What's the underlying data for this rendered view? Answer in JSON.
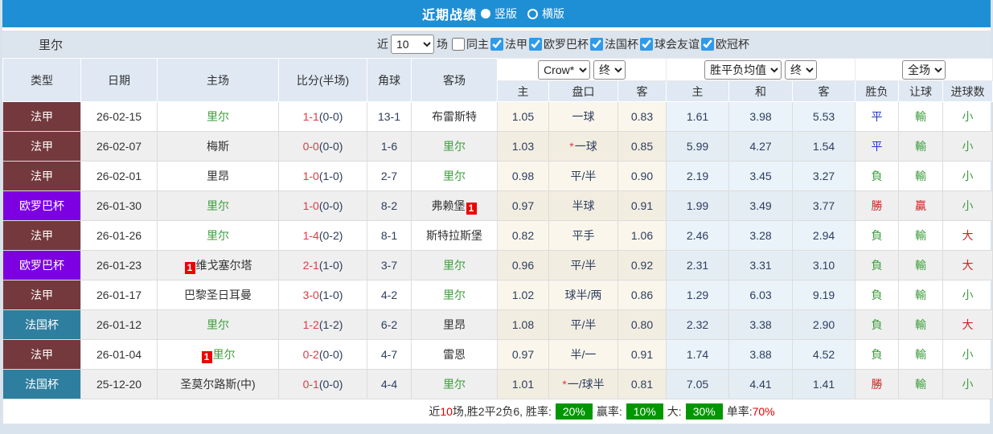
{
  "colors": {
    "css": {
      "bar-blue": "#1f8fd5",
      "check-blue": "#2e9bea",
      "team-green": "#3c9e3c",
      "score-red": "#dd3b45",
      "badge-red": "#ee0000",
      "res-red": "#cc2222",
      "res-blue": "#2233cc",
      "ink-navy": "#2c3e5d",
      "footer-green": "#009700",
      "footer-red": "#e00000"
    },
    "type": {
      "法甲": "#74393c",
      "欧罗巴杯": "#7c00e2",
      "法国杯": "#2e7e9f"
    },
    "result": {
      "勝": "red",
      "贏": "red",
      "大": "red",
      "平": "blue",
      "負": "green",
      "輸": "green",
      "小": "green"
    }
  },
  "title_bar": {
    "title": "近期战绩",
    "radio_vertical": "竖版",
    "radio_horizontal": "横版"
  },
  "filter_bar": {
    "team": "里尔",
    "near_label": "近",
    "count_value": "10",
    "games_label": "场",
    "same_venue_label": "同主",
    "leagues": [
      "法甲",
      "欧罗巴杯",
      "法国杯",
      "球会友谊",
      "欧冠杯"
    ]
  },
  "table": {
    "left_headers": [
      "类型",
      "日期",
      "主场",
      "比分(半场)",
      "角球",
      "客场"
    ],
    "dropdowns": {
      "crow": "Crow*",
      "final1": "终",
      "avg": "胜平负均值",
      "final2": "终",
      "fullmatch": "全场"
    },
    "sub_headers": [
      "主",
      "盘口",
      "客",
      "主",
      "和",
      "客",
      "胜负",
      "让球",
      "进球数"
    ],
    "rows": [
      {
        "type": "法甲",
        "date": "26-02-15",
        "home": {
          "name": "里尔",
          "green": true
        },
        "score": "1-1",
        "half": "(0-0)",
        "corner": "13-1",
        "away": {
          "name": "布雷斯特",
          "green": false
        },
        "crow": [
          "1.05",
          "一球",
          "0.83"
        ],
        "star": false,
        "euro": [
          "1.61",
          "3.98",
          "5.53"
        ],
        "results": [
          "平",
          "輸",
          "小"
        ]
      },
      {
        "type": "法甲",
        "date": "26-02-07",
        "home": {
          "name": "梅斯",
          "green": false
        },
        "score": "0-0",
        "half": "(0-0)",
        "corner": "1-6",
        "away": {
          "name": "里尔",
          "green": true
        },
        "crow": [
          "1.03",
          "一球",
          "0.85"
        ],
        "star": true,
        "euro": [
          "5.99",
          "4.27",
          "1.54"
        ],
        "results": [
          "平",
          "輸",
          "小"
        ]
      },
      {
        "type": "法甲",
        "date": "26-02-01",
        "home": {
          "name": "里昂",
          "green": false
        },
        "score": "1-0",
        "half": "(1-0)",
        "corner": "2-7",
        "away": {
          "name": "里尔",
          "green": true
        },
        "crow": [
          "0.98",
          "平/半",
          "0.90"
        ],
        "star": false,
        "euro": [
          "2.19",
          "3.45",
          "3.27"
        ],
        "results": [
          "負",
          "輸",
          "小"
        ]
      },
      {
        "type": "欧罗巴杯",
        "date": "26-01-30",
        "home": {
          "name": "里尔",
          "green": true
        },
        "score": "1-0",
        "half": "(0-0)",
        "corner": "8-2",
        "away": {
          "name": "弗赖堡",
          "green": false,
          "badge_after": "1"
        },
        "crow": [
          "0.97",
          "半球",
          "0.91"
        ],
        "star": false,
        "euro": [
          "1.99",
          "3.49",
          "3.77"
        ],
        "results": [
          "勝",
          "贏",
          "小"
        ]
      },
      {
        "type": "法甲",
        "date": "26-01-26",
        "home": {
          "name": "里尔",
          "green": true
        },
        "score": "1-4",
        "half": "(0-2)",
        "corner": "8-1",
        "away": {
          "name": "斯特拉斯堡",
          "green": false
        },
        "crow": [
          "0.82",
          "平手",
          "1.06"
        ],
        "star": false,
        "euro": [
          "2.46",
          "3.28",
          "2.94"
        ],
        "results": [
          "負",
          "輸",
          "大"
        ]
      },
      {
        "type": "欧罗巴杯",
        "date": "26-01-23",
        "home": {
          "name": "维戈塞尔塔",
          "green": false,
          "badge_before": "1"
        },
        "score": "2-1",
        "half": "(1-0)",
        "corner": "3-7",
        "away": {
          "name": "里尔",
          "green": true
        },
        "crow": [
          "0.96",
          "平/半",
          "0.92"
        ],
        "star": false,
        "euro": [
          "2.31",
          "3.31",
          "3.10"
        ],
        "results": [
          "負",
          "輸",
          "大"
        ]
      },
      {
        "type": "法甲",
        "date": "26-01-17",
        "home": {
          "name": "巴黎圣日耳曼",
          "green": false
        },
        "score": "3-0",
        "half": "(1-0)",
        "corner": "4-2",
        "away": {
          "name": "里尔",
          "green": true
        },
        "crow": [
          "1.02",
          "球半/两",
          "0.86"
        ],
        "star": false,
        "euro": [
          "1.29",
          "6.03",
          "9.19"
        ],
        "results": [
          "負",
          "輸",
          "小"
        ]
      },
      {
        "type": "法国杯",
        "date": "26-01-12",
        "home": {
          "name": "里尔",
          "green": true
        },
        "score": "1-2",
        "half": "(1-2)",
        "corner": "6-2",
        "away": {
          "name": "里昂",
          "green": false
        },
        "crow": [
          "1.08",
          "平/半",
          "0.80"
        ],
        "star": false,
        "euro": [
          "2.32",
          "3.38",
          "2.90"
        ],
        "results": [
          "負",
          "輸",
          "大"
        ]
      },
      {
        "type": "法甲",
        "date": "26-01-04",
        "home": {
          "name": "里尔",
          "green": true,
          "badge_before": "1"
        },
        "score": "0-2",
        "half": "(0-0)",
        "corner": "4-7",
        "away": {
          "name": "雷恩",
          "green": false
        },
        "crow": [
          "0.97",
          "半/一",
          "0.91"
        ],
        "star": false,
        "euro": [
          "1.74",
          "3.88",
          "4.52"
        ],
        "results": [
          "負",
          "輸",
          "小"
        ]
      },
      {
        "type": "法国杯",
        "date": "25-12-20",
        "home": {
          "name": "圣莫尔路斯(中)",
          "green": false
        },
        "score": "0-1",
        "half": "(0-0)",
        "corner": "4-4",
        "away": {
          "name": "里尔",
          "green": true
        },
        "crow": [
          "1.01",
          "一/球半",
          "0.81"
        ],
        "star": true,
        "euro": [
          "7.05",
          "4.41",
          "1.41"
        ],
        "results": [
          "勝",
          "輸",
          "小"
        ]
      }
    ]
  },
  "footer": {
    "prefix": "近",
    "count_red": "10",
    "summary": "场,胜2平2负6, 胜率:",
    "win_rate_badge": "20%",
    "handicap_label": "赢率:",
    "handicap_badge": "10%",
    "big_label": "大:",
    "big_badge": "30%",
    "single_label": "单率:",
    "single_rate": "70%"
  }
}
